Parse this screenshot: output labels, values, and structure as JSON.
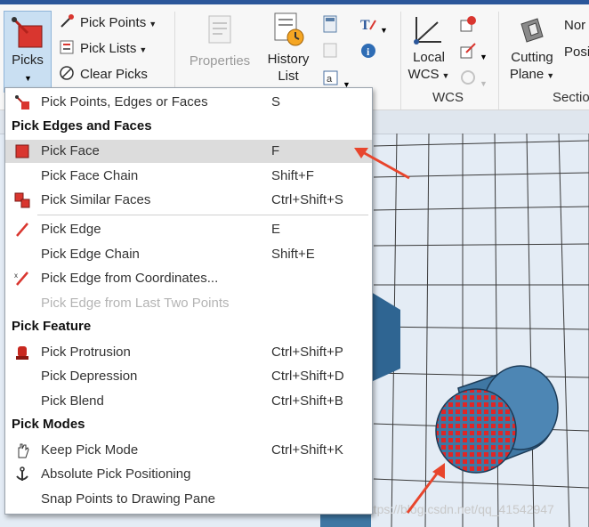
{
  "ribbon": {
    "picks_label": "Picks",
    "pick_points": "Pick Points",
    "pick_lists": "Pick Lists",
    "clear_picks": "Clear Picks",
    "properties": "Properties",
    "history_list": [
      "History",
      "List"
    ],
    "local_wcs": [
      "Local",
      "WCS"
    ],
    "wcs_group": "WCS",
    "cutting_plane": [
      "Cutting",
      "Plane"
    ],
    "normal_cut": "Nor",
    "position_cut": "Posi",
    "section_group": "Sectio"
  },
  "menu": {
    "items": [
      {
        "label": "Pick Points, Edges or Faces",
        "shortcut": "S",
        "icon": "pick-points-edges-faces-icon"
      },
      {
        "header": "Pick Edges and Faces"
      },
      {
        "label": "Pick Face",
        "shortcut": "F",
        "icon": "pick-face-icon",
        "highlighted": true
      },
      {
        "label": "Pick Face Chain",
        "shortcut": "Shift+F"
      },
      {
        "label": "Pick Similar Faces",
        "shortcut": "Ctrl+Shift+S",
        "icon": "similar-faces-icon"
      },
      {
        "label": "Pick Edge",
        "shortcut": "E",
        "icon": "pick-edge-icon"
      },
      {
        "label": "Pick Edge Chain",
        "shortcut": "Shift+E"
      },
      {
        "label": "Pick Edge from Coordinates...",
        "shortcut": "",
        "icon": "edge-from-coordinates-icon"
      },
      {
        "label": "Pick Edge from Last Two Points",
        "shortcut": "",
        "disabled": true
      },
      {
        "header": "Pick Feature"
      },
      {
        "label": "Pick Protrusion",
        "shortcut": "Ctrl+Shift+P",
        "icon": "protrusion-icon"
      },
      {
        "label": "Pick Depression",
        "shortcut": "Ctrl+Shift+D"
      },
      {
        "label": "Pick Blend",
        "shortcut": "Ctrl+Shift+B"
      },
      {
        "header": "Pick Modes"
      },
      {
        "label": "Keep Pick Mode",
        "shortcut": "Ctrl+Shift+K",
        "icon": "hand-icon"
      },
      {
        "label": "Absolute Pick Positioning",
        "shortcut": "",
        "icon": "anchor-icon"
      },
      {
        "label": "Snap Points to Drawing Pane",
        "shortcut": ""
      }
    ]
  },
  "watermark": "https://blog.csdn.net/qq_41542947",
  "colors": {
    "accent": "#2b579a",
    "pick_red": "#d9362f",
    "model_blue": "#3f77a3",
    "highlight": "#dcdcdc"
  }
}
